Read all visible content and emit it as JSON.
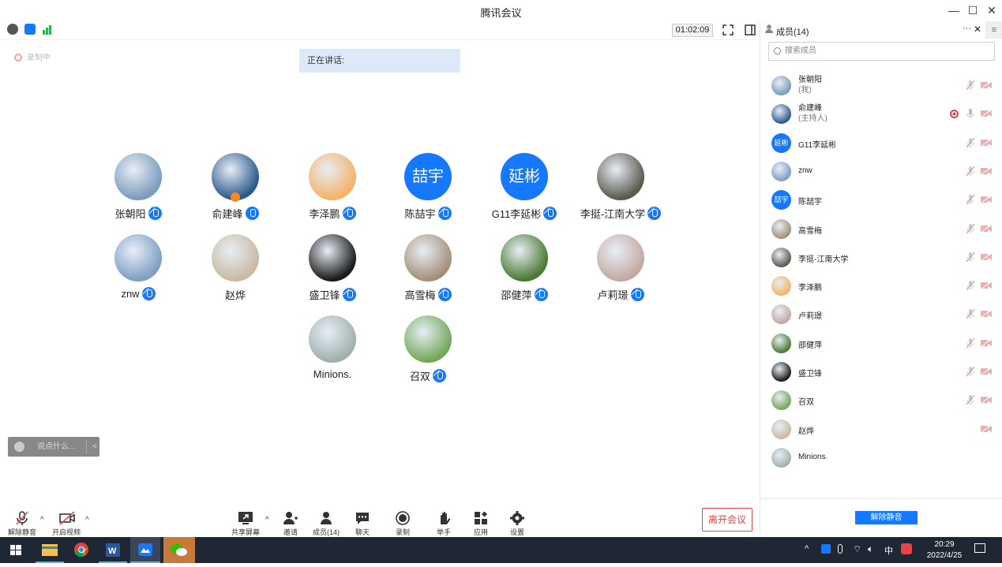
{
  "window": {
    "title": "腾讯会议",
    "minimize": "—",
    "maximize": "☐",
    "close": "✕"
  },
  "toolbar": {
    "timer": "01:02:09"
  },
  "meeting": {
    "recording_label": "录制中",
    "speaking_label": "正在讲话:",
    "participants": [
      {
        "name": "张朝阳",
        "avatar_color": "#7a9cbf",
        "mic": "muted"
      },
      {
        "name": "俞建峰",
        "avatar_color": "#2d5a8c",
        "mic": "on",
        "host": true
      },
      {
        "name": "李泽鹏",
        "avatar_color": "#f3b36a",
        "mic": "muted"
      },
      {
        "name": "陈喆宇",
        "avatar_text": "喆宇",
        "mic": "muted"
      },
      {
        "name": "G11李延彬",
        "avatar_text": "延彬",
        "mic": "muted"
      },
      {
        "name": "李挺-江南大学",
        "avatar_color": "#5a5a4e",
        "mic": "muted"
      },
      {
        "name": "znw",
        "avatar_color": "#7f9fc6",
        "mic": "muted"
      },
      {
        "name": "赵烨",
        "avatar_color": "#c9b9a4",
        "mic": "none"
      },
      {
        "name": "盛卫锋",
        "avatar_color": "#1b1b1b",
        "mic": "muted"
      },
      {
        "name": "高雪梅",
        "avatar_color": "#a58f79",
        "mic": "muted"
      },
      {
        "name": "邵健萍",
        "avatar_color": "#4a7a33",
        "mic": "muted"
      },
      {
        "name": "卢莉璟",
        "avatar_color": "#c4a9a3",
        "mic": "muted"
      },
      {
        "name": "Minions.",
        "avatar_color": "#9fb1ad",
        "mic": "none"
      },
      {
        "name": "召双",
        "avatar_color": "#73a85a",
        "mic": "muted"
      }
    ],
    "chat_placeholder": "说点什么...",
    "chat_toggle": "<"
  },
  "bottom": {
    "unmute": "解除静音",
    "start_video": "开启视频",
    "share": "共享屏幕",
    "invite": "邀请",
    "members": "成员(14)",
    "chat": "聊天",
    "record": "录制",
    "raise_hand": "举手",
    "apps": "应用",
    "settings": "设置",
    "leave": "离开会议",
    "caret": "^"
  },
  "panel": {
    "title": "成员(14)",
    "more": "···",
    "close": "✕",
    "search_placeholder": "搜索成员",
    "unmute_all": "解除静音",
    "members": [
      {
        "name": "张朝阳",
        "sub": "(我)",
        "avatar_color": "#7a9cbf"
      },
      {
        "name": "俞建峰",
        "sub": "(主持人)",
        "avatar_color": "#2d5a8c",
        "recording": true
      },
      {
        "name": "G11李延彬",
        "avatar_text": "延彬"
      },
      {
        "name": "znw",
        "avatar_color": "#7f9fc6"
      },
      {
        "name": "陈喆宇",
        "avatar_text": "喆宇"
      },
      {
        "name": "高雪梅",
        "avatar_color": "#a58f79"
      },
      {
        "name": "李挺-江南大学",
        "avatar_color": "#5a5a4e"
      },
      {
        "name": "李泽鹏",
        "avatar_color": "#f3b36a"
      },
      {
        "name": "卢莉璟",
        "avatar_color": "#c4a9a3"
      },
      {
        "name": "邵健萍",
        "avatar_color": "#4a7a33"
      },
      {
        "name": "盛卫锋",
        "avatar_color": "#1b1b1b"
      },
      {
        "name": "召双",
        "avatar_color": "#73a85a"
      },
      {
        "name": "赵烨",
        "avatar_color": "#c9b9a4",
        "no_mic": true
      },
      {
        "name": "Minions.",
        "avatar_color": "#9fb1ad",
        "no_mic": true,
        "no_cam": true
      }
    ]
  },
  "taskbar": {
    "time": "20:29",
    "date": "2022/4/25",
    "ime": "中",
    "chevron": "^"
  }
}
